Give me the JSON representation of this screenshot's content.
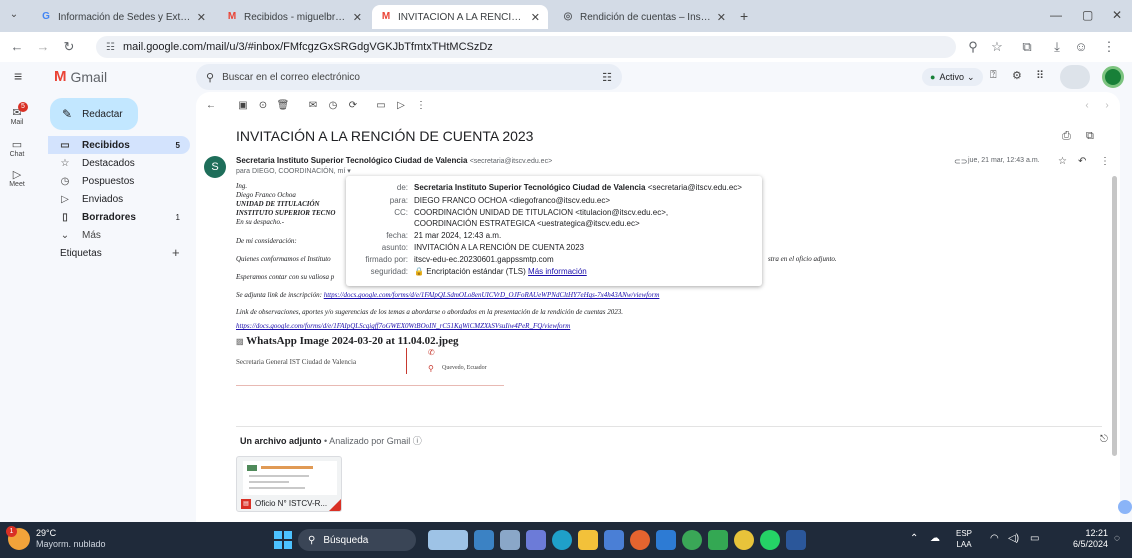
{
  "browser": {
    "tabs": [
      {
        "label": "Información de Sedes y Extensi",
        "favicon": "G",
        "fav_color": "#4285f4",
        "active": false
      },
      {
        "label": "Recibidos - miguelbriones@itsc",
        "favicon": "M",
        "fav_color": "#ea4335",
        "active": false
      },
      {
        "label": "INVITACIÓN A LA RENCIÓN DE",
        "favicon": "M",
        "fav_color": "#ea4335",
        "active": true
      },
      {
        "label": "Rendición de cuentas – Instituto",
        "favicon": "globe",
        "fav_color": "#5f6368",
        "active": false
      }
    ],
    "new_tab": "+",
    "url": "mail.google.com/mail/u/3/#inbox/FMfcgzGxSRGdgVGKJbTfmtxTHtMCSzDz"
  },
  "gmail": {
    "logo_text": "Gmail",
    "search_placeholder": "Buscar en el correo electrónico",
    "status": "Activo",
    "compose_label": "Redactar",
    "rail": [
      {
        "icon": "mail-icon",
        "label": "Mail",
        "badge": "5"
      },
      {
        "icon": "chat-icon",
        "label": "Chat"
      },
      {
        "icon": "meet-icon",
        "label": "Meet"
      }
    ],
    "folders": [
      {
        "icon": "inbox-icon",
        "glyph": "▭",
        "label": "Recibidos",
        "count": "5",
        "bold": true
      },
      {
        "icon": "star-icon",
        "glyph": "☆",
        "label": "Destacados",
        "count": ""
      },
      {
        "icon": "clock-icon",
        "glyph": "◷",
        "label": "Pospuestos",
        "count": ""
      },
      {
        "icon": "send-icon",
        "glyph": "▷",
        "label": "Enviados",
        "count": ""
      },
      {
        "icon": "draft-icon",
        "glyph": "▯",
        "label": "Borradores",
        "count": "1",
        "bold": true
      },
      {
        "icon": "chevron-down-icon",
        "glyph": "⌄",
        "label": "Más",
        "count": ""
      }
    ],
    "labels_heading": "Etiquetas",
    "labels_add": "+"
  },
  "email": {
    "subject": "INVITACIÓN A LA RENCIÓN DE CUENTA 2023",
    "avatar_letter": "S",
    "sender_name": "Secretaria Instituto Superior Tecnológico Ciudad de Valencia",
    "sender_email": "<secretaria@itscv.edu.ec>",
    "to_line": "para DIEGO, COORDINACIÓN, mí",
    "date": "jue, 21 mar, 12:43 a.m.",
    "body": {
      "line1": "Ing.",
      "line2": "Diego Franco Ochoa",
      "line3": "UNIDAD DE TITULACIÓN",
      "line4": "INSTITUTO SUPERIOR TECNO",
      "line5": "En su despacho.-",
      "line6": "De mi consideración:",
      "line7": "Quienes conformamos el Instituto",
      "line7_tail": "stra en el oficio adjunto.",
      "line8": "Esperamos contar con su valiosa p",
      "inscription_prefix": "Se adjunta link de inscripción:",
      "inscription_link": "https://docs.google.com/forms/d/e/1FAIpQLSdmOLo8enUICVrD_OJFoRAUeWPNdCltHY7eHqs-7x4h43ANw/viewform",
      "observations": "Link de observaciones, aportes y/o sugerencias de los temas a abordarse o abordados en la presentación de la rendición de cuentas 2023.",
      "observations_link": "https://docs.google.com/forms/d/e/1FAIpQLScqigff7oGWEX0WtBOoIN_rC51KgWiCMZXkSVsuIiw4PeR_FQ/viewform",
      "image_alt": "WhatsApp Image 2024-03-20 at 11.04.02.jpeg",
      "signature": "Secretaria General IST Ciudad de Valencia",
      "location": "Quevedo, Ecuador"
    },
    "attachment_heading": "Un archivo adjunto",
    "attachment_scan": "• Analizado por Gmail",
    "attachment_name": "Oficio N° ISTCV-R..."
  },
  "details": {
    "rows": [
      {
        "label": "de:",
        "value": "Secretaria Instituto Superior Tecnológico Ciudad de Valencia",
        "extra": "<secretaria@itscv.edu.ec>",
        "bold": true
      },
      {
        "label": "para:",
        "value": "DIEGO FRANCO OCHOA <diegofranco@itscv.edu.ec>"
      },
      {
        "label": "CC:",
        "value": "COORDINACIÓN UNIDAD DE TITULACION <titulacion@itscv.edu.ec>,"
      },
      {
        "label": "",
        "value": "COORDINACIÓN ESTRATEGICA <uestrategica@itscv.edu.ec>"
      },
      {
        "label": "fecha:",
        "value": "21 mar 2024, 12:43 a.m."
      },
      {
        "label": "asunto:",
        "value": "INVITACIÓN A LA RENCIÓN DE CUENTA 2023"
      },
      {
        "label": "firmado por:",
        "value": "itscv-edu-ec.20230601.gappssmtp.com"
      },
      {
        "label": "seguridad:",
        "value": "Encriptación estándar (TLS)",
        "link": "Más información"
      }
    ]
  },
  "taskbar": {
    "weather_temp": "29°C",
    "weather_desc": "Mayorm. nublado",
    "weather_badge": "1",
    "search_label": "Búsqueda",
    "lang": "ESP",
    "lang2": "LAA",
    "time": "12:21",
    "date": "6/5/2024"
  }
}
